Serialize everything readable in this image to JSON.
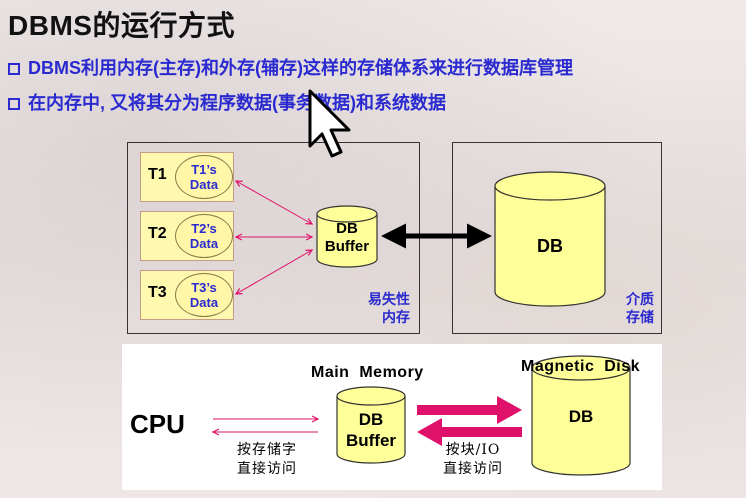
{
  "title": "DBMS的运行方式",
  "bullets": [
    "DBMS利用内存(主存)和外存(辅存)这样的存储体系来进行数据库管理",
    "在内存中, 又将其分为程序数据(事务数据)和系统数据"
  ],
  "upper_diagram": {
    "transactions": [
      {
        "label": "T1",
        "data_line1": "T1’s",
        "data_line2": "Data"
      },
      {
        "label": "T2",
        "data_line1": "T2’s",
        "data_line2": "Data"
      },
      {
        "label": "T3",
        "data_line1": "T3’s",
        "data_line2": "Data"
      }
    ],
    "buffer_line1": "DB",
    "buffer_line2": "Buffer",
    "volatile_line1": "易失性",
    "volatile_line2": "内存",
    "db_label": "DB",
    "storage_line1": "介质",
    "storage_line2": "存储"
  },
  "lower_diagram": {
    "cpu": "CPU",
    "main_memory": "Main  Memory",
    "buffer_line1": "DB",
    "buffer_line2": "Buffer",
    "magnetic_disk": "Magnetic  Disk",
    "db_label": "DB",
    "left_caption_line1": "按存储字",
    "left_caption_line2": "直接访问",
    "right_caption_line1": "按块/IO",
    "right_caption_line2": "直接访问"
  },
  "colors": {
    "accent_blue": "#2a2ad0",
    "cylinder_yellow": "#ffff99",
    "arrow_pink": "#e0116a"
  }
}
